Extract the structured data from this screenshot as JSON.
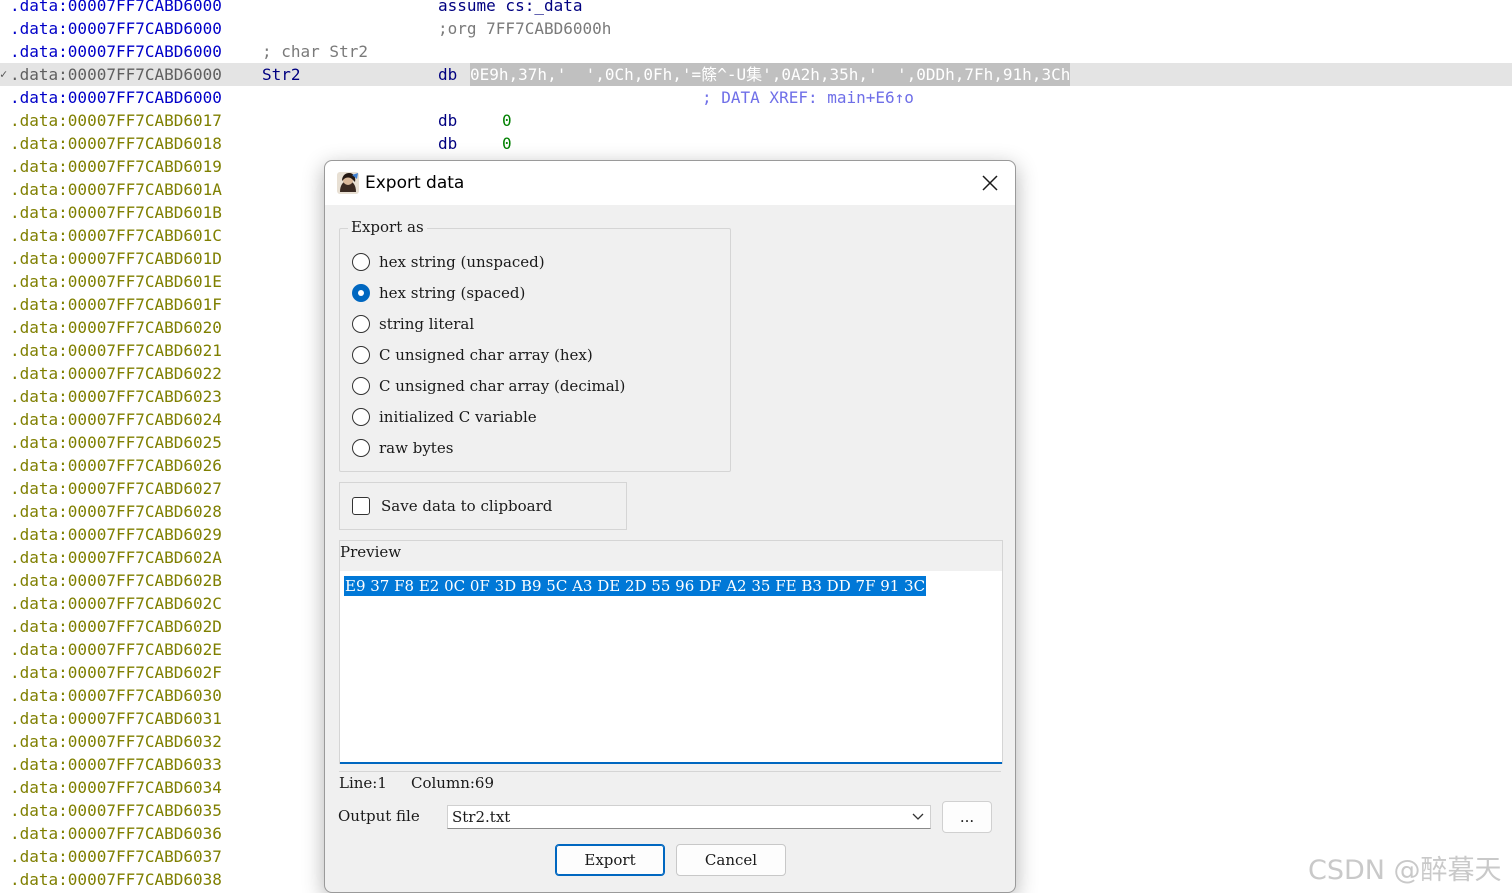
{
  "listing": {
    "header_lines": [
      {
        "addr": ".data:00007FF7CABD6000",
        "code": "assume cs:_data"
      },
      {
        "addr": ".data:00007FF7CABD6000",
        "code": ";org 7FF7CABD6000h"
      }
    ],
    "comment_line": {
      "addr": ".data:00007FF7CABD6000",
      "comment": "; char Str2"
    },
    "selected_line": {
      "marker": "✓",
      "addr": ".data:00007FF7CABD6000",
      "label": "Str2",
      "mnemonic": "db",
      "value": "0E9h,37h,'  ',0Ch,0Fh,'=篨^-U集',0A2h,35h,'  ',0DDh,7Fh,91h,3Ch"
    },
    "xref_line": {
      "addr": ".data:00007FF7CABD6000",
      "xref": "; DATA XREF: main+E6↑o"
    },
    "db_lines": [
      {
        "addr": ".data:00007FF7CABD6017",
        "mnemonic": "db",
        "value": "0"
      },
      {
        "addr": ".data:00007FF7CABD6018",
        "mnemonic": "db",
        "value": "0"
      }
    ],
    "data_lines": [
      ".data:00007FF7CABD6019",
      ".data:00007FF7CABD601A",
      ".data:00007FF7CABD601B",
      ".data:00007FF7CABD601C",
      ".data:00007FF7CABD601D",
      ".data:00007FF7CABD601E",
      ".data:00007FF7CABD601F",
      ".data:00007FF7CABD6020",
      ".data:00007FF7CABD6021",
      ".data:00007FF7CABD6022",
      ".data:00007FF7CABD6023",
      ".data:00007FF7CABD6024",
      ".data:00007FF7CABD6025",
      ".data:00007FF7CABD6026",
      ".data:00007FF7CABD6027",
      ".data:00007FF7CABD6028",
      ".data:00007FF7CABD6029",
      ".data:00007FF7CABD602A",
      ".data:00007FF7CABD602B",
      ".data:00007FF7CABD602C",
      ".data:00007FF7CABD602D",
      ".data:00007FF7CABD602E",
      ".data:00007FF7CABD602F",
      ".data:00007FF7CABD6030",
      ".data:00007FF7CABD6031",
      ".data:00007FF7CABD6032",
      ".data:00007FF7CABD6033",
      ".data:00007FF7CABD6034",
      ".data:00007FF7CABD6035",
      ".data:00007FF7CABD6036",
      ".data:00007FF7CABD6037",
      ".data:00007FF7CABD6038"
    ]
  },
  "dialog": {
    "title": "Export data",
    "app_icon": "ida-portrait-icon",
    "close_icon": "close-icon",
    "export_as": {
      "title": "Export as",
      "options": [
        {
          "label": "hex string (unspaced)",
          "selected": false
        },
        {
          "label": "hex string (spaced)",
          "selected": true
        },
        {
          "label": "string literal",
          "selected": false
        },
        {
          "label": "C unsigned char array (hex)",
          "selected": false
        },
        {
          "label": "C unsigned char array (decimal)",
          "selected": false
        },
        {
          "label": "initialized C variable",
          "selected": false
        },
        {
          "label": "raw bytes",
          "selected": false
        }
      ]
    },
    "clipboard": {
      "label": "Save data to clipboard",
      "checked": false
    },
    "preview": {
      "label": "Preview",
      "text": "E9 37 F8 E2 0C 0F 3D B9 5C A3 DE 2D 55 96 DF A2 35 FE B3 DD 7F 91 3C"
    },
    "status": {
      "line": "Line:1",
      "column": "Column:69"
    },
    "output_file": {
      "label": "Output file",
      "value": "Str2.txt",
      "browse_label": "..."
    },
    "buttons": {
      "export": "Export",
      "cancel": "Cancel"
    }
  },
  "watermark": "CSDN @醉暮天",
  "colors": {
    "accent": "#0067c0",
    "selection": "#0078d7",
    "data_addr": "#7f7f00",
    "code_addr": "#0000c8",
    "number": "#008000"
  }
}
